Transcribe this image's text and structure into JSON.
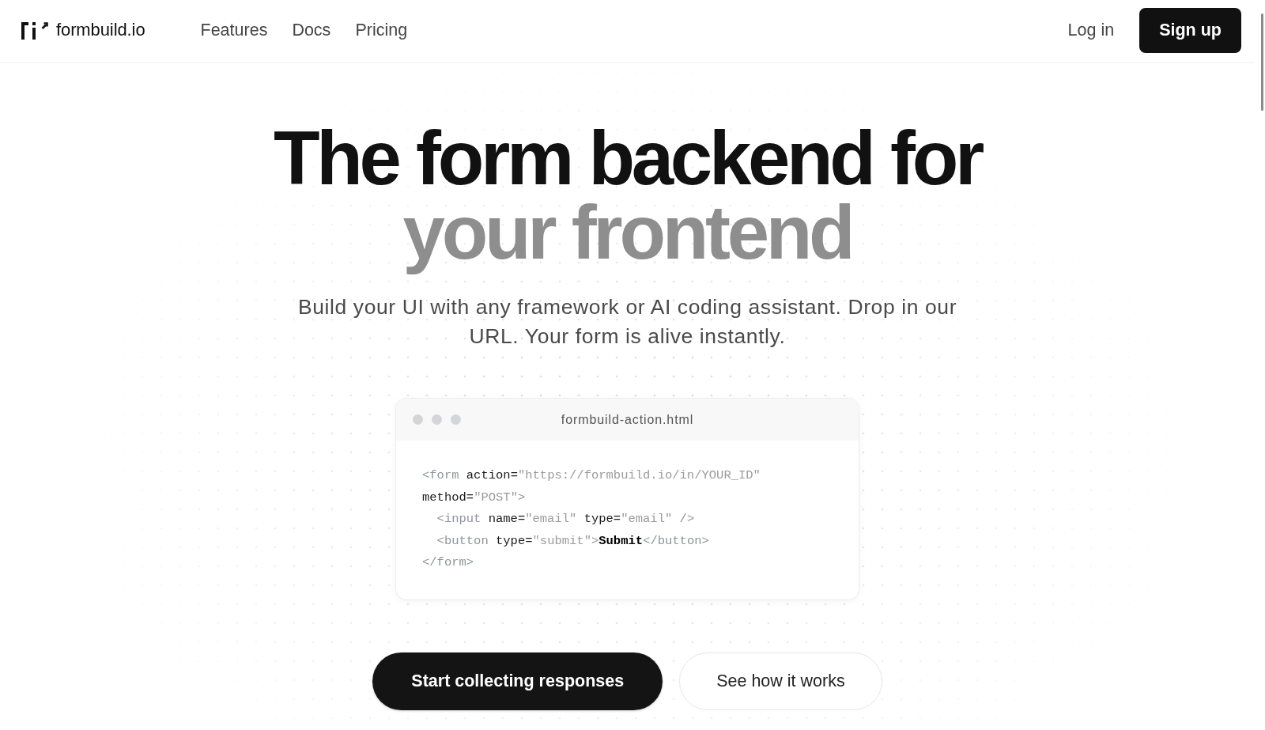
{
  "header": {
    "logo": {
      "text": "formbuild.io"
    },
    "nav": [
      {
        "label": "Features"
      },
      {
        "label": "Docs"
      },
      {
        "label": "Pricing"
      }
    ],
    "login": {
      "label": "Log in"
    },
    "signup": {
      "label": "Sign up"
    }
  },
  "hero": {
    "title": "The form backend for",
    "title_accent": "your frontend",
    "subtitle": "Build your UI with any framework or AI coding assistant. Drop in our URL. Your form is alive instantly.",
    "code_window": {
      "filename": "formbuild-action.html",
      "lines": [
        {
          "tokens": [
            {
              "kind": "tag",
              "text": "<form"
            },
            {
              "kind": "attr",
              "text": " action="
            },
            {
              "kind": "string",
              "text": "\"https://formbuild.io/in/YOUR_ID\""
            },
            {
              "kind": "attr",
              "text": " method="
            },
            {
              "kind": "string",
              "text": "\"POST\""
            },
            {
              "kind": "tag",
              "text": ">"
            }
          ],
          "children": [
            {
              "tokens": [
                {
                  "kind": "tag",
                  "text": "<input"
                },
                {
                  "kind": "attr",
                  "text": " name="
                },
                {
                  "kind": "string",
                  "text": "\"email\""
                },
                {
                  "kind": "attr",
                  "text": " type="
                },
                {
                  "kind": "string",
                  "text": "\"email\""
                },
                {
                  "kind": "tag",
                  "text": " />"
                }
              ]
            },
            {
              "tokens": [
                {
                  "kind": "tag",
                  "text": "<button"
                },
                {
                  "kind": "attr",
                  "text": " type="
                },
                {
                  "kind": "string",
                  "text": "\"submit\""
                },
                {
                  "kind": "tag",
                  "text": ">"
                },
                {
                  "kind": "content",
                  "text": "Submit"
                },
                {
                  "kind": "tag",
                  "text": "</button>"
                }
              ]
            }
          ]
        },
        {
          "tokens": [
            {
              "kind": "tag",
              "text": "</form>"
            }
          ]
        }
      ]
    },
    "actions": [
      {
        "label": "Start collecting responses",
        "kind": "primary"
      },
      {
        "label": "See how it works",
        "kind": "secondary"
      }
    ]
  }
}
